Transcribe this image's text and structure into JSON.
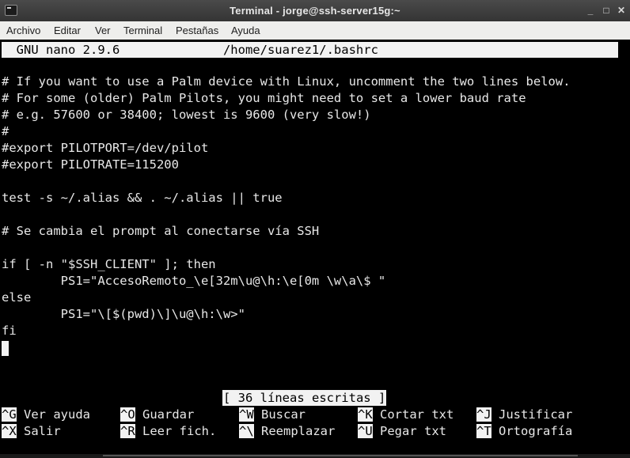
{
  "window": {
    "title": "Terminal - jorge@ssh-server15g:~",
    "minimize_glyph": "_",
    "maximize_glyph": "□",
    "close_glyph": "✕"
  },
  "menu": [
    "Archivo",
    "Editar",
    "Ver",
    "Terminal",
    "Pestañas",
    "Ayuda"
  ],
  "nano": {
    "header": "  GNU nano 2.9.6              /home/suarez1/.bashrc",
    "lines": [
      "# If you want to use a Palm device with Linux, uncomment the two lines below.",
      "# For some (older) Palm Pilots, you might need to set a lower baud rate",
      "# e.g. 57600 or 38400; lowest is 9600 (very slow!)",
      "#",
      "#export PILOTPORT=/dev/pilot",
      "#export PILOTRATE=115200",
      "",
      "test -s ~/.alias && . ~/.alias || true",
      "",
      "# Se cambia el prompt al conectarse vía SSH",
      "",
      "if [ -n \"$SSH_CLIENT\" ]; then",
      "        PS1=\"AccesoRemoto_\\e[32m\\u@\\h:\\e[0m \\w\\a\\$ \"",
      "else",
      "        PS1=\"\\[$(pwd)\\]\\u@\\h:\\w>\"",
      "fi"
    ],
    "status": "[ 36 líneas escritas ]",
    "shortcuts_row1": [
      {
        "key": "^G",
        "label": " Ver ayuda"
      },
      {
        "key": "^O",
        "label": " Guardar"
      },
      {
        "key": "^W",
        "label": " Buscar"
      },
      {
        "key": "^K",
        "label": " Cortar txt"
      },
      {
        "key": "^J",
        "label": " Justificar"
      }
    ],
    "shortcuts_row2": [
      {
        "key": "^X",
        "label": " Salir"
      },
      {
        "key": "^R",
        "label": " Leer fich."
      },
      {
        "key": "^\\",
        "label": " Reemplazar"
      },
      {
        "key": "^U",
        "label": " Pegar txt"
      },
      {
        "key": "^T",
        "label": " Ortografía"
      }
    ]
  }
}
